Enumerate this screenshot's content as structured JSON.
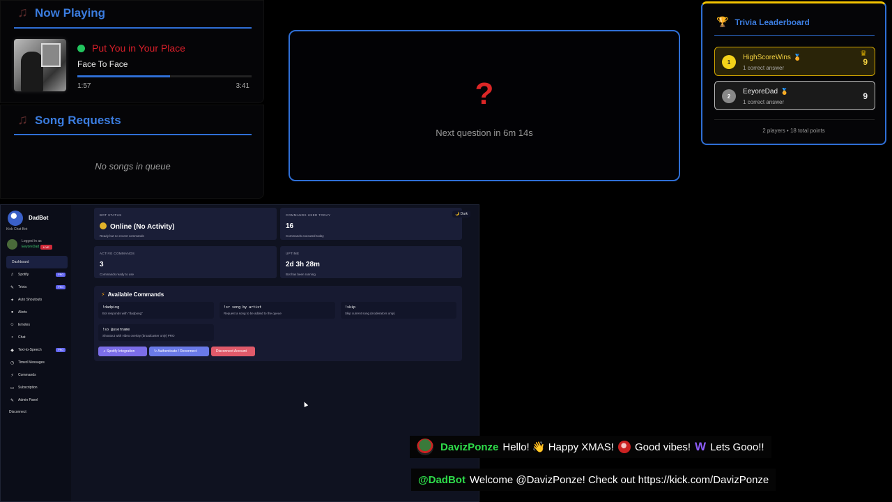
{
  "now_playing": {
    "title": "Now Playing",
    "song": "Put You in Your Place",
    "artist": "Face To Face",
    "progress": 0.53,
    "current_time": "1:57",
    "total_time": "3:41"
  },
  "song_requests": {
    "title": "Song Requests",
    "empty": "No songs in queue"
  },
  "trivia": {
    "icon": "?",
    "next_question": "Next question in 6m 14s"
  },
  "leaderboard": {
    "title": "Trivia Leaderboard",
    "entries": [
      {
        "rank": "1",
        "name": "HighScoreWins",
        "sub": "1 correct answer",
        "score": "9"
      },
      {
        "rank": "2",
        "name": "EeyoreDad",
        "sub": "1 correct answer",
        "score": "9"
      }
    ],
    "footer": "2 players • 18 total points"
  },
  "dashboard": {
    "brand": "DadBot",
    "brand_sub": "Kick Chat Bot",
    "logged_label": "Logged in as",
    "logged_user": "EeyoreDad",
    "live": "LIVE",
    "nav": [
      {
        "label": "Dashboard",
        "icon": ""
      },
      {
        "label": "Spotify",
        "icon": "♫",
        "pro": "PRO"
      },
      {
        "label": "Trivia",
        "icon": "✎",
        "pro": "PRO"
      },
      {
        "label": "Auto Shoutouts",
        "icon": "✦"
      },
      {
        "label": "Alerts",
        "icon": "●"
      },
      {
        "label": "Emotes",
        "icon": "☺"
      },
      {
        "label": "Chat",
        "icon": "▪"
      },
      {
        "label": "Text-to-Speech",
        "icon": "◆",
        "pro": "PRO"
      },
      {
        "label": "Timed Messages",
        "icon": "◷"
      },
      {
        "label": "Commands",
        "icon": "⚡"
      },
      {
        "label": "Subscription",
        "icon": "▭"
      },
      {
        "label": "Admin Panel",
        "icon": "✎"
      }
    ],
    "disconnect": "Disconnect",
    "dark_toggle": "🌙 Dark",
    "stats": {
      "status_label": "BOT STATUS",
      "status_value": "Online (No Activity)",
      "status_desc": "Ready but no recent commands",
      "used_label": "COMMANDS USED TODAY",
      "used_value": "16",
      "used_desc": "Commands executed today",
      "active_label": "ACTIVE COMMANDS",
      "active_value": "3",
      "active_desc": "Commands ready to use",
      "uptime_label": "UPTIME",
      "uptime_value": "2d 3h 28m",
      "uptime_desc": "Bot has been running"
    },
    "commands_title": "Available Commands",
    "commands": [
      {
        "name": "!dadping",
        "desc": "Bot responds with \"dadpong\""
      },
      {
        "name": "!sr song by artist",
        "desc": "Request a song to be added to the queue"
      },
      {
        "name": "!skip",
        "desc": "Skip current song (moderators only)"
      },
      {
        "name": "!so @username",
        "desc": "Shoutout with video overlay (broadcaster only) PRO"
      }
    ],
    "buttons": {
      "spotify": "♫ Spotify Integration",
      "auth": "↻ Authenticate / Reconnect",
      "disconnect": "Disconnect Account"
    }
  },
  "chat": [
    {
      "user": "DavizPonze",
      "parts": [
        "Hello! 👋 Happy XMAS!",
        "Good vibes!",
        "Lets Gooo!!"
      ]
    },
    {
      "user": "@DadBot",
      "message": "Welcome @DavizPonze! Check out https://kick.com/DavizPonze"
    }
  ],
  "colors": {
    "accent": "#2f6fd6",
    "song_title": "#d81f2a",
    "gold": "#f3c300",
    "chat_user": "#2edc4a"
  }
}
